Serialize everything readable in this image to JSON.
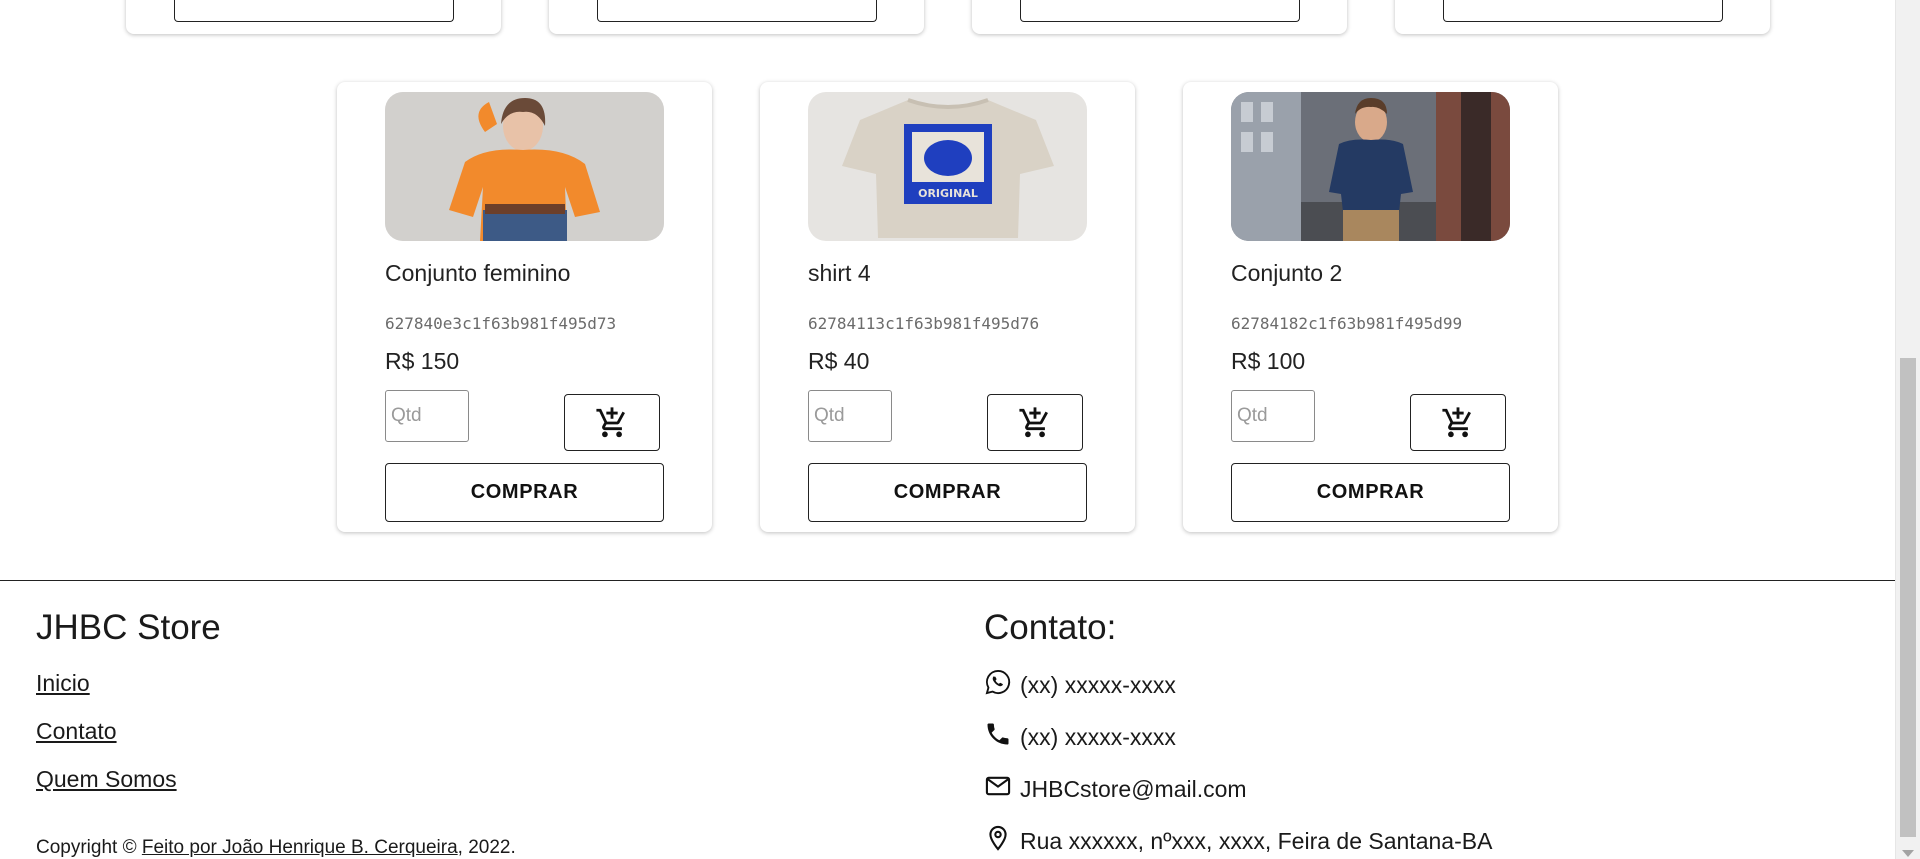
{
  "products": [
    {
      "name": "Conjunto feminino",
      "id": "627840e3c1f63b981f495d73",
      "price": "R$ 150",
      "image": "woman-orange-sweater-photo"
    },
    {
      "name": "shirt 4",
      "id": "62784113c1f63b981f495d76",
      "price": "R$ 40",
      "image": "original-graphic-tshirt-photo"
    },
    {
      "name": "Conjunto 2",
      "id": "62784182c1f63b981f495d99",
      "price": "R$ 100",
      "image": "man-denim-shirt-city-photo"
    }
  ],
  "card_labels": {
    "qty_placeholder": "Qtd",
    "buy_label": "COMPRAR",
    "cart_icon": "add-shopping-cart-icon"
  },
  "footer": {
    "brand": "JHBC Store",
    "links": [
      "Inicio",
      "Contato",
      "Quem Somos"
    ],
    "copyright_prefix": "Copyright © ",
    "copyright_link": "Feito por João Henrique B. Cerqueira",
    "copyright_suffix": ", 2022.",
    "contact_title": "Contato:",
    "contacts": [
      {
        "icon": "whatsapp-icon",
        "text": "(xx) xxxxx-xxxx"
      },
      {
        "icon": "phone-icon",
        "text": "(xx) xxxxx-xxxx"
      },
      {
        "icon": "mail-icon",
        "text": "JHBCstore@mail.com"
      },
      {
        "icon": "location-pin-icon",
        "text": "Rua xxxxxx, nºxxx, xxxx, Feira de Santana-BA"
      }
    ]
  },
  "colors": {
    "text": "#1e1e1e",
    "muted_id": "#6b6b6b",
    "card_shadow": "rgba(0,0,0,0.25)",
    "scrollbar_thumb": "#c1c1c1"
  }
}
